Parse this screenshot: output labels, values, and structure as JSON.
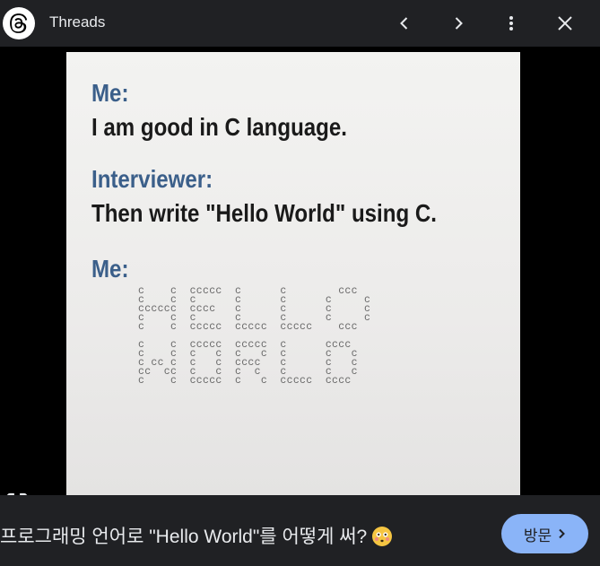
{
  "header": {
    "title": "Threads",
    "icons": [
      "threads-logo-icon",
      "chevron-left-icon",
      "chevron-right-icon",
      "more-vert-icon",
      "close-icon"
    ]
  },
  "meme": {
    "lines": [
      {
        "role": "speaker",
        "text": "Me:"
      },
      {
        "role": "speech",
        "text": "I am good in C language."
      },
      {
        "role": "speaker",
        "text": "Interviewer:"
      },
      {
        "role": "speech",
        "text": "Then write \"Hello World\" using C."
      },
      {
        "role": "speaker",
        "text": "Me:"
      }
    ],
    "ascii_art": "c    c  ccccc  c      c        ccc\nc    c  c      c      c      c     c\ncccccc  cccc   c      c      c     c\nc    c  c      c      c      c     c\nc    c  ccccc  ccccc  ccccc    ccc\n\nc    c  ccccc  ccccc  c      cccc\nc    c  c   c  c   c  c      c   c\nc cc c  c   c  cccc   c      c   c\ncc  cc  c   c  c  c   c      c   c\nc    c  ccccc  c   c  ccccc  cccc"
  },
  "footer": {
    "caption": "프로그래밍 언어로 \"Hello World\"를 어떻게 써?",
    "emoji": "flushed-face-icon",
    "visit_label": "방문"
  },
  "colors": {
    "bar": "#202124",
    "accent": "#8ab4f8",
    "speaker": "#3b5f8a"
  }
}
